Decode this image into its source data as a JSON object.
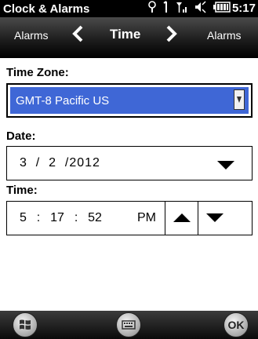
{
  "status": {
    "app_title": "Clock & Alarms",
    "time": "5:17",
    "icons": [
      "connectivity-icon",
      "bluetooth-icon",
      "signal-icon",
      "volume-icon",
      "battery-icon"
    ]
  },
  "nav": {
    "left_label": "Alarms",
    "center_label": "Time",
    "right_label": "Alarms"
  },
  "time_zone": {
    "label": "Time Zone:",
    "value": "GMT-8 Pacific US"
  },
  "date": {
    "label": "Date:",
    "value": "3  /  2  /2012"
  },
  "time": {
    "label": "Time:",
    "value": "5  :  17  :  52",
    "ampm": "PM"
  },
  "softkeys": {
    "ok_label": "OK"
  },
  "colors": {
    "selection": "#3f67d6",
    "status_bg": "#000000"
  }
}
